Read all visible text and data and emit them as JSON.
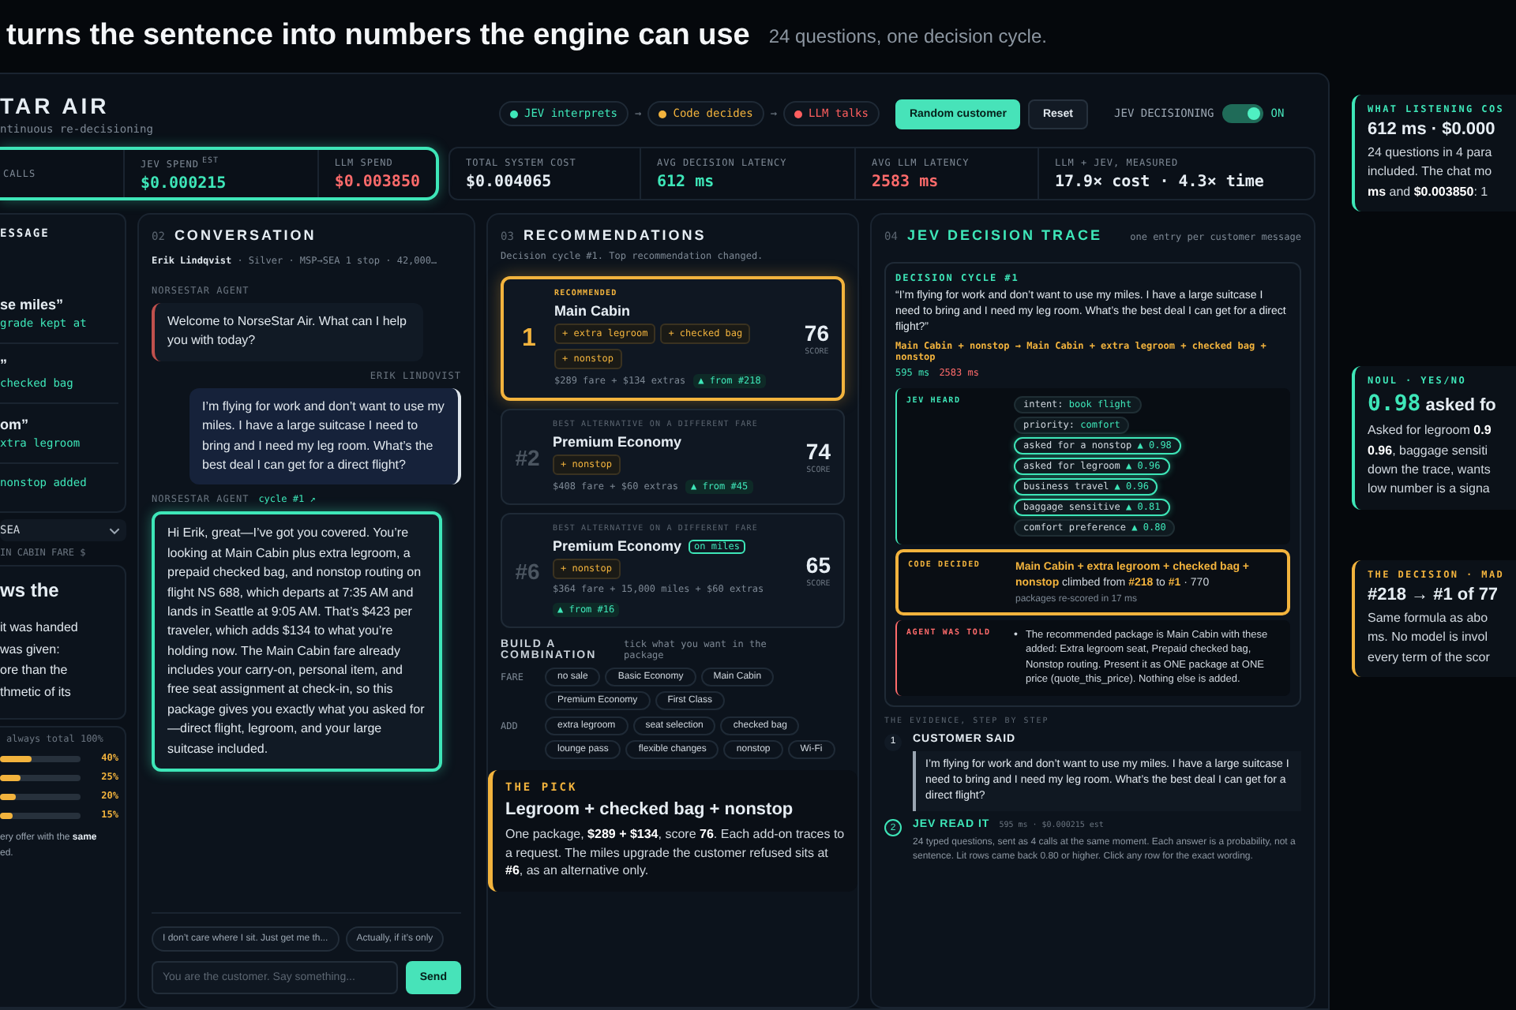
{
  "headline": {
    "title": "turns the sentence into numbers the engine can use",
    "subtitle": "24 questions, one decision cycle."
  },
  "app": {
    "brand": "TAR AIR",
    "tagline": "ntinuous re-decisioning",
    "pipeline": [
      {
        "label": "JEV interprets",
        "color": "#3ee6b8"
      },
      {
        "label": "Code decides",
        "color": "#f2b33d"
      },
      {
        "label": "LLM talks",
        "color": "#ff5f5f"
      }
    ],
    "arrow": "→",
    "buttons": [
      {
        "label": "Random customer",
        "kind": "primary"
      },
      {
        "label": "Reset",
        "kind": "secondary"
      }
    ],
    "toggle": {
      "label": "JEV DECISIONING",
      "on": true,
      "state_label": "ON"
    }
  },
  "metrics": {
    "highlighted": [
      {
        "label": "CALLS"
      },
      {
        "label": "JEV SPEND",
        "sup": "EST",
        "value": "$0.000215",
        "kind": "jev"
      },
      {
        "label": "LLM SPEND",
        "value": "$0.003850",
        "kind": "llm"
      }
    ],
    "others": [
      {
        "label": "TOTAL SYSTEM COST",
        "value": "$0.004065",
        "kind": "plain"
      },
      {
        "label": "AVG DECISION LATENCY",
        "value": "612 ms",
        "kind": "jev"
      },
      {
        "label": "AVG LLM LATENCY",
        "value": "2583 ms",
        "kind": "llm"
      },
      {
        "label": "LLM + JEV, MEASURED",
        "value": "17.9× cost · 4.3× time",
        "kind": "plain"
      }
    ]
  },
  "messages_panel": {
    "title": "ESSAGE",
    "items": [
      {
        "quote": "se miles”",
        "change": "grade kept at"
      },
      {
        "quote": "”",
        "change": "checked bag"
      },
      {
        "quote": "om”",
        "change": "xtra legroom"
      },
      {
        "change": "nonstop added"
      }
    ],
    "route": "SEA",
    "fare_label": "IN CABIN FARE $",
    "explainer": {
      "title": "ws the",
      "lines": [
        "it was handed",
        "was given:",
        "ore than the",
        "thmetic of its"
      ]
    },
    "weights": {
      "note": "always total 100%",
      "sliders": [
        {
          "level": 0.4,
          "reading": "40%"
        },
        {
          "level": 0.25,
          "reading": "25%"
        },
        {
          "level": 0.2,
          "reading": "20%"
        },
        {
          "level": 0.15,
          "reading": "15%"
        }
      ],
      "footer_lines": [
        "ery offer with the **same**",
        "ed."
      ]
    }
  },
  "conversation": {
    "index": "02",
    "title": "CONVERSATION",
    "customer_line": "**Erik Lindqvist** · Silver · MSP→SEA 1 stop · 42,000…",
    "messages": [
      {
        "kind": "agent",
        "sender": "NORSESTAR AGENT",
        "text": "Welcome to NorseStar Air. What can I help you with today?",
        "highlighted": false
      },
      {
        "kind": "customer",
        "sender": "ERIK LINDQVIST",
        "text": "I’m flying for work and don’t want to use my miles. I have a large suitcase I need to bring and I need my leg room. What’s the best deal I can get for a direct flight?",
        "highlighted": false
      },
      {
        "kind": "agent",
        "sender": "NORSESTAR AGENT",
        "cycle": "cycle #1 ↗",
        "text": "Hi Erik, great—I’ve got you covered. You’re looking at Main Cabin plus extra legroom, a prepaid checked bag, and nonstop routing on flight NS 688, which departs at 7:35 AM and lands in Seattle at 9:05 AM. That’s $423 per traveler, which adds $134 to what you’re holding now. The Main Cabin fare already includes your carry-on, personal item, and free seat assignment at check-in, so this package gives you exactly what you asked for—direct flight, legroom, and your large suitcase included.",
        "highlighted": true
      }
    ],
    "suggestions": [
      "I don’t care where I sit. Just get me th...",
      "Actually, if it’s only"
    ],
    "input_placeholder": "You are the customer. Say something...",
    "send": "Send"
  },
  "recommendations": {
    "index": "03",
    "title": "RECOMMENDATIONS",
    "subtitle": "Decision cycle #1. Top recommendation changed.",
    "cards": [
      {
        "rank": "1",
        "top": true,
        "eyebrow": "RECOMMENDED",
        "name": "Main Cabin",
        "addons": [
          "+ extra legroom",
          "+ checked bag",
          "+ nonstop"
        ],
        "price": "$289 fare + $134 extras",
        "from": "▲ from #218",
        "score": "76",
        "score_label": "SCORE"
      },
      {
        "rank": "#2",
        "top": false,
        "eyebrow": "BEST ALTERNATIVE ON A DIFFERENT FARE",
        "name": "Premium Economy",
        "addons": [
          "+ nonstop"
        ],
        "price": "$408 fare + $60 extras",
        "from": "▲ from #45",
        "score": "74",
        "score_label": "SCORE"
      },
      {
        "rank": "#6",
        "top": false,
        "eyebrow": "BEST ALTERNATIVE ON A DIFFERENT FARE",
        "name": "Premium Economy",
        "badge": "on miles",
        "addons": [
          "+ nonstop"
        ],
        "price": "$364 fare + 15,000 miles + $60 extras",
        "from": "▲ from #16",
        "score": "65",
        "score_label": "SCORE"
      }
    ],
    "build": {
      "title": "BUILD A COMBINATION",
      "hint": "tick what you want in the package",
      "groups": [
        {
          "label": "FARE",
          "options": [
            "no sale",
            "Basic Economy",
            "Main Cabin",
            "Premium Economy",
            "First Class"
          ]
        },
        {
          "label": "ADD",
          "options": [
            "extra legroom",
            "seat selection",
            "checked bag",
            "lounge pass",
            "flexible changes",
            "nonstop",
            "Wi-Fi"
          ]
        }
      ]
    },
    "pick": {
      "eyebrow": "THE PICK",
      "title": "Legroom + checked bag + nonstop",
      "text": "One package, **$289 + $134**, score **76**. Each add-on traces to a request. The miles upgrade the customer refused sits at **#6**, as an alternative only."
    }
  },
  "trace": {
    "index": "04",
    "title": "JEV DECISION TRACE",
    "hint": "one entry per customer message",
    "cycle": {
      "label": "DECISION CYCLE #1",
      "quote": "“I’m flying for work and don’t want to use my miles. I have a large suitcase I need to bring and I need my leg room. What’s the best deal I can get for a direct flight?”",
      "change": "Main Cabin + nonstop → Main Cabin + extra legroom + checked bag + nonstop",
      "jev_time": "595 ms",
      "llm_time": "2583 ms"
    },
    "heard": {
      "label": "JEV HEARD",
      "tags": [
        {
          "key": "intent:",
          "value": "book flight"
        },
        {
          "key": "priority:",
          "value": "comfort"
        }
      ],
      "signals": [
        {
          "label": "asked for a nonstop",
          "score": "▲ 0.98",
          "lit": true
        },
        {
          "label": "asked for legroom",
          "score": "▲ 0.96",
          "lit": true
        },
        {
          "label": "business travel",
          "score": "▲ 0.96",
          "lit": true
        },
        {
          "label": "baggage sensitive",
          "score": "▲ 0.81",
          "lit": true
        },
        {
          "label": "comfort preference",
          "score": "▲ 0.80",
          "lit": false
        }
      ]
    },
    "decided": {
      "label": "CODE DECIDED",
      "text": "**Main Cabin + extra legroom + checked bag + nonstop** climbed from **#218** to **#1** · 770",
      "note": "packages re-scored in 17 ms"
    },
    "told": {
      "label": "AGENT WAS TOLD",
      "bullet": "•",
      "items": [
        "The recommended package is Main Cabin with these added: Extra legroom seat, Prepaid checked bag, Nonstop routing. Present it as ONE package at ONE price (quote_this_price). Nothing else is added."
      ]
    },
    "evidence": {
      "title": "THE EVIDENCE, STEP BY STEP",
      "steps": [
        {
          "number": "1",
          "kind": "quote",
          "title": "CUSTOMER SAID",
          "body": "I’m flying for work and don’t want to use my miles. I have a large suitcase I need to bring and I need my leg room. What’s the best deal I can get for a direct flight?"
        },
        {
          "number": "2",
          "kind": "text",
          "title": "JEV READ IT",
          "meta": "595 ms · $0.000215 est",
          "body": "24 typed questions, sent as 4 calls at the same moment. Each answer is a probability, not a sentence. Lit rows came back 0.80 or higher. Click any row for the exact wording."
        }
      ]
    }
  },
  "callouts": [
    {
      "kind": "jev",
      "eyebrow": "WHAT LISTENING COS",
      "headline": "612 ms · $0.000",
      "lines": [
        "24 questions in 4 para",
        "included. The chat mo",
        "**ms** and **$0.003850**: 1"
      ]
    },
    {
      "kind": "jev",
      "eyebrow": "NOUL · YES/NO",
      "value": "0.98",
      "headline": "asked fo",
      "lines": [
        "Asked for legroom **0.9**",
        "**0.96**, baggage sensiti",
        "down the trace, wants",
        "low number is a signa"
      ]
    },
    {
      "kind": "code",
      "eyebrow": "THE DECISION · MAD",
      "headline": "#218 → #1 of 77",
      "lines": [
        "Same formula as abo",
        "ms. No model is invol",
        "every term of the scor"
      ]
    }
  ]
}
